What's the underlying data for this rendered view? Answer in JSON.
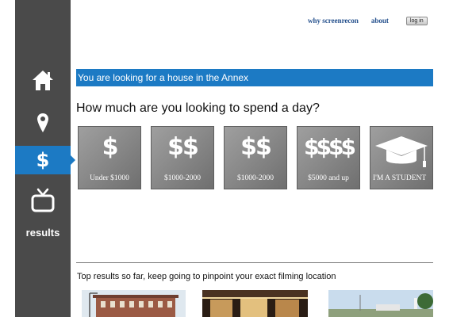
{
  "sidebar": {
    "items": [
      {
        "name": "home",
        "icon": "home-icon"
      },
      {
        "name": "location",
        "icon": "location-pin-icon"
      },
      {
        "name": "budget",
        "icon": "dollar-icon",
        "glyph": "$",
        "active": true
      },
      {
        "name": "tv",
        "icon": "tv-icon"
      }
    ],
    "results_label": "results"
  },
  "nav": {
    "why_label": "why screenrecon",
    "about_label": "about",
    "login_label": "log in"
  },
  "banner": {
    "text": "You are looking for a house in the Annex"
  },
  "question": {
    "text": "How much are you looking to spend a day?"
  },
  "options": [
    {
      "symbol": "$",
      "label": "Under $1000"
    },
    {
      "symbol": "$$",
      "label": "$1000-2000"
    },
    {
      "symbol": "$$",
      "label": "$1000-2000"
    },
    {
      "symbol": "$$$$",
      "label": "$5000 and up"
    },
    {
      "icon": "graduation-cap-icon",
      "label": "I'M A STUDENT"
    }
  ],
  "results": {
    "text": "Top results so far, keep going to pinpoint your exact filming location",
    "thumbnails": [
      "location-photo-1",
      "location-photo-2",
      "location-photo-3"
    ]
  },
  "colors": {
    "sidebar": "#4a4a4a",
    "accent": "#1c7ac4",
    "nav_link": "#234f8c"
  }
}
